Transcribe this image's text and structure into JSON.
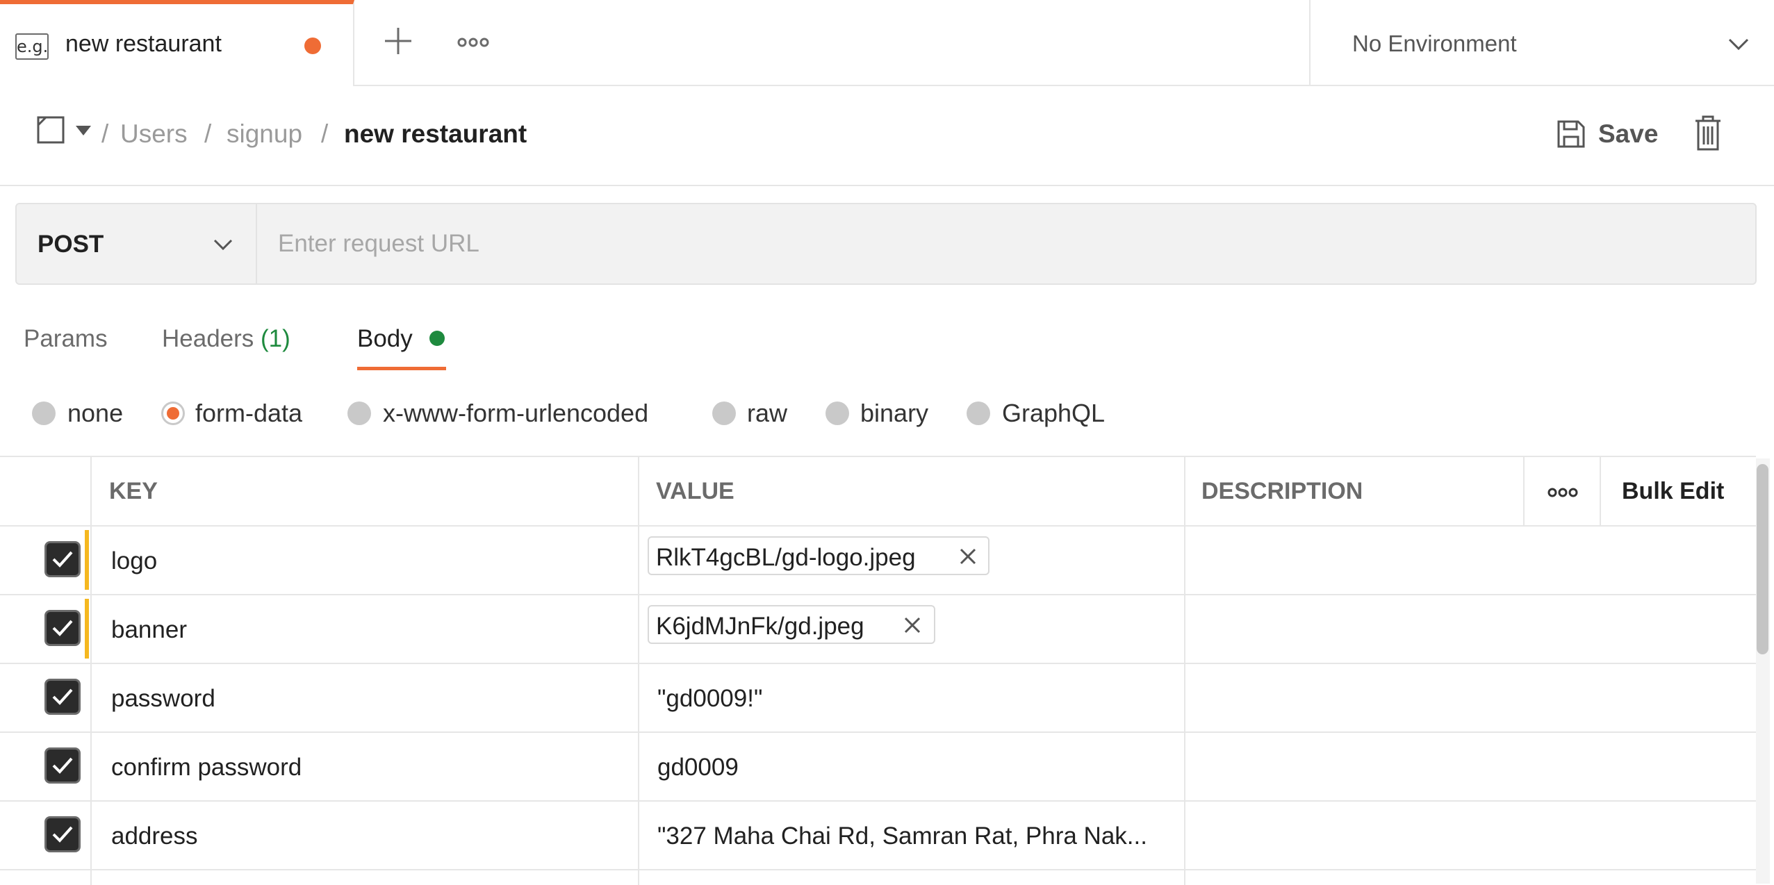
{
  "tabs": {
    "active": {
      "icon_text": "e.g.",
      "title": "new restaurant"
    },
    "new_tab_icon": "plus-icon",
    "more_icon": "more-horizontal-icon"
  },
  "environment": {
    "label": "No Environment",
    "icon": "chevron-down-icon"
  },
  "breadcrumb": {
    "separator": "/",
    "items": [
      "Users",
      "signup"
    ],
    "current": "new restaurant"
  },
  "toolbar": {
    "save_label": "Save",
    "delete_icon": "trash-icon"
  },
  "request": {
    "method": "POST",
    "url_placeholder": "Enter request URL",
    "url_value": ""
  },
  "request_tabs": {
    "params": "Params",
    "headers": "Headers",
    "headers_count": "(1)",
    "body": "Body"
  },
  "body_types": {
    "selected": "form-data",
    "options": [
      "none",
      "form-data",
      "x-www-form-urlencoded",
      "raw",
      "binary",
      "GraphQL"
    ]
  },
  "table": {
    "headers": {
      "key": "KEY",
      "value": "VALUE",
      "description": "DESCRIPTION",
      "more_icon": "more-horizontal-icon",
      "bulk_edit": "Bulk Edit"
    },
    "rows": [
      {
        "checked": true,
        "key": "logo",
        "value": "RlkT4gcBL/gd-logo.jpeg",
        "type": "file"
      },
      {
        "checked": true,
        "key": "banner",
        "value": "K6jdMJnFk/gd.jpeg",
        "type": "file"
      },
      {
        "checked": true,
        "key": "password",
        "value": "\"gd0009!\"",
        "type": "text"
      },
      {
        "checked": true,
        "key": "confirm password",
        "value": "gd0009",
        "type": "text"
      },
      {
        "checked": true,
        "key": "address",
        "value": "\"327 Maha Chai Rd, Samran Rat, Phra Nak...",
        "type": "text"
      }
    ]
  },
  "colors": {
    "accent": "#ef6c35",
    "success": "#1e8a3e",
    "marker": "#f5b820"
  }
}
